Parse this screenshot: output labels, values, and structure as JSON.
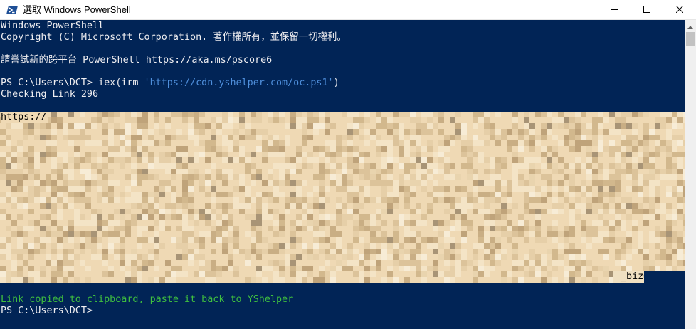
{
  "window": {
    "title": "選取 Windows PowerShell",
    "icon": "powershell-icon",
    "controls": [
      "minimize-icon",
      "maximize-icon",
      "close-icon"
    ]
  },
  "console": {
    "lines": {
      "l1": "Windows PowerShell",
      "l2": "Copyright (C) Microsoft Corporation. 著作權所有，並保留一切權利。",
      "l3": "請嘗試新的跨平台 PowerShell https://aka.ms/pscore6",
      "l4_prompt": "PS C:\\Users\\DCT> iex(irm ",
      "l4_string": "'https://cdn.yshelper.com/oc.ps1'",
      "l4_end": ")",
      "l5": "Checking Link 296",
      "sel_prefix": "https://",
      "sel_tail": "_biz=",
      "l6": "Link copied to clipboard, paste it back to YShelper",
      "l7": "PS C:\\Users\\DCT>"
    },
    "colors": {
      "background": "#012456",
      "text": "#eeedf0",
      "string": "#4f8fdc",
      "success": "#3fbf3f",
      "selection": "#efd9b4"
    }
  }
}
